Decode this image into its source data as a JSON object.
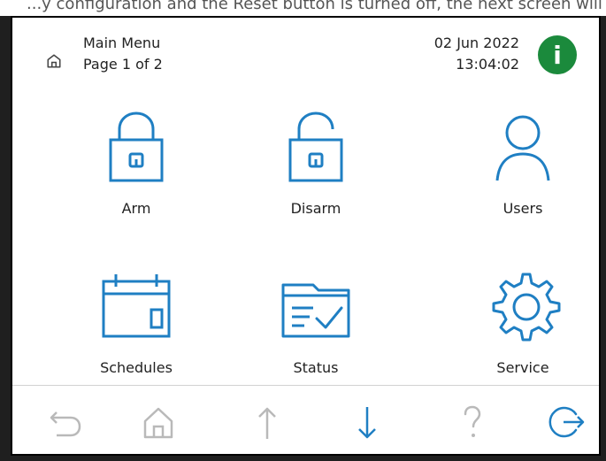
{
  "top_clip_text": "...y configuration and the Reset button is turned off, the next screen will appear.",
  "header": {
    "title": "Main Menu",
    "subtitle": "Page 1 of 2",
    "date": "02 Jun 2022",
    "time": "13:04:02"
  },
  "tiles": [
    {
      "label": "Arm"
    },
    {
      "label": "Disarm"
    },
    {
      "label": "Users"
    },
    {
      "label": "Schedules"
    },
    {
      "label": "Status"
    },
    {
      "label": "Service"
    }
  ],
  "colors": {
    "accent": "#1f7fc3",
    "muted": "#b9b9b9",
    "info_green": "#1b8a3c"
  },
  "nav": {
    "back_icon": "back-icon",
    "home_icon": "home-icon",
    "up_icon": "arrow-up-icon",
    "down_icon": "arrow-down-icon",
    "help_icon": "help-icon",
    "logout_icon": "logout-icon"
  }
}
